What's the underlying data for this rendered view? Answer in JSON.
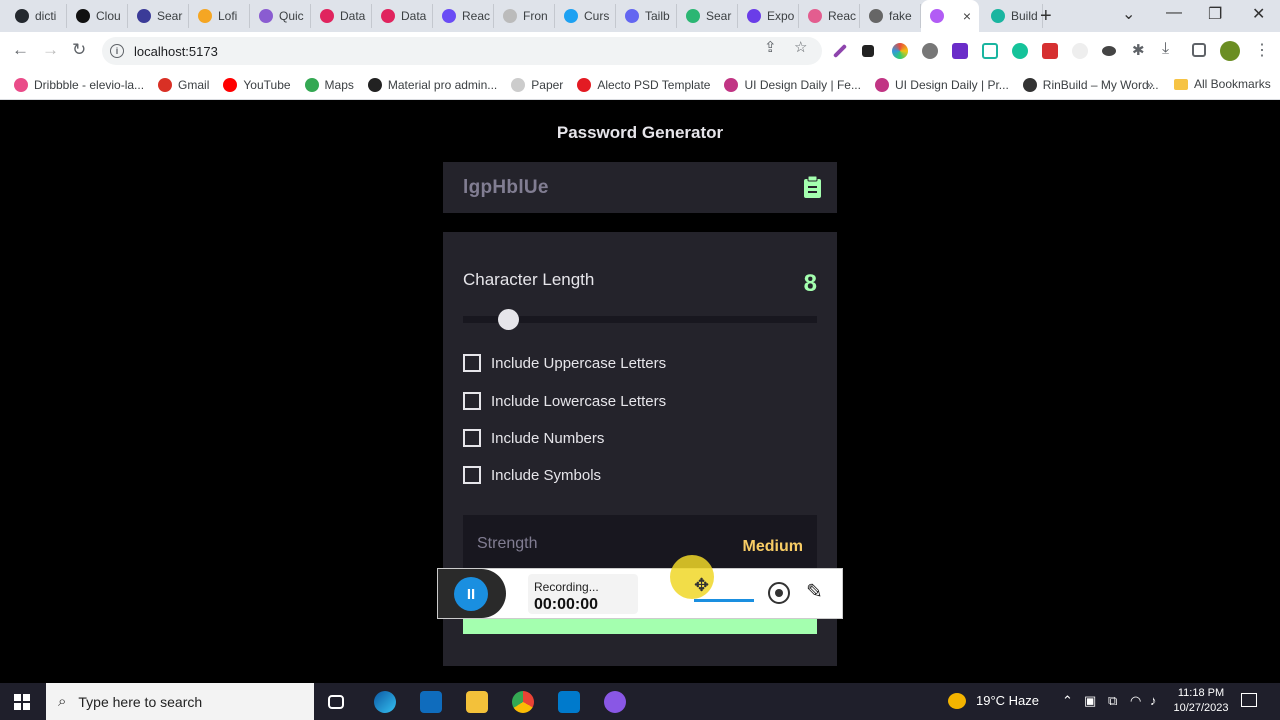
{
  "browser": {
    "tabs": [
      {
        "label": "dicti",
        "color": "#24292f"
      },
      {
        "label": "Clou",
        "color": "#111111"
      },
      {
        "label": "Sear",
        "color": "#3b3b98"
      },
      {
        "label": "Lofi",
        "color": "#f5a623"
      },
      {
        "label": "Quic",
        "color": "#8a5cd1"
      },
      {
        "label": "Data",
        "color": "#e0245e"
      },
      {
        "label": "Data",
        "color": "#e0245e"
      },
      {
        "label": "Reac",
        "color": "#6a4cf5"
      },
      {
        "label": "Fron",
        "color": "#bbbbbb"
      },
      {
        "label": "Curs",
        "color": "#1da1f2"
      },
      {
        "label": "Tailb",
        "color": "#6366f1"
      },
      {
        "label": "Sear",
        "color": "#2bb673"
      },
      {
        "label": "Expo",
        "color": "#6a3de8"
      },
      {
        "label": "Reac",
        "color": "#e35d8f"
      },
      {
        "label": "fake",
        "color": "#666666"
      },
      {
        "label": "",
        "color": "#b25cf5",
        "active": true
      },
      {
        "label": "Build",
        "color": "#1ab5a0"
      }
    ],
    "active_tab_close": "×",
    "new_tab": "+",
    "window_controls": {
      "dropdown": "⌄",
      "minimize": "—",
      "restore": "❐",
      "close": "✕"
    },
    "url": "localhost:5173",
    "info_icon": "i",
    "bookmarks": [
      {
        "label": "Dribbble - elevio-la...",
        "color": "#ea4c89"
      },
      {
        "label": "Gmail",
        "color": "#d93025"
      },
      {
        "label": "YouTube",
        "color": "#ff0000"
      },
      {
        "label": "Maps",
        "color": "#34a853"
      },
      {
        "label": "Material pro admin...",
        "color": "#222222"
      },
      {
        "label": "Paper",
        "color": "#cccccc"
      },
      {
        "label": "Alecto PSD Template",
        "color": "#e31b23"
      },
      {
        "label": "UI Design Daily | Fe...",
        "color": "#c13584"
      },
      {
        "label": "UI Design Daily | Pr...",
        "color": "#c13584"
      },
      {
        "label": "RinBuild – My Word...",
        "color": "#333333"
      }
    ],
    "bookmarks_more": "»",
    "all_bookmarks": "All Bookmarks"
  },
  "app": {
    "title": "Password Generator",
    "password": "lgpHblUe",
    "character_length_label": "Character Length",
    "character_length_value": "8",
    "slider_fraction": 0.1,
    "options": [
      {
        "label": "Include Uppercase Letters",
        "checked": false
      },
      {
        "label": "Include Lowercase Letters",
        "checked": false
      },
      {
        "label": "Include Numbers",
        "checked": false
      },
      {
        "label": "Include Symbols",
        "checked": false
      }
    ],
    "strength_label": "Strength",
    "strength_value": "Medium",
    "colors": {
      "accent": "#a4ffaf",
      "strength": "#f8cd65",
      "card": "#24232b",
      "dark": "#18171f"
    }
  },
  "recorder": {
    "status": "Recording...",
    "time": "00:00:00",
    "pause_symbol": "II"
  },
  "taskbar": {
    "search_placeholder": "Type here to search",
    "apps": [
      "task-view",
      "edge",
      "mail",
      "file-explorer",
      "chrome",
      "vscode",
      "github-desktop"
    ],
    "weather": "19°C  Haze",
    "time": "11:18 PM",
    "date": "10/27/2023"
  }
}
